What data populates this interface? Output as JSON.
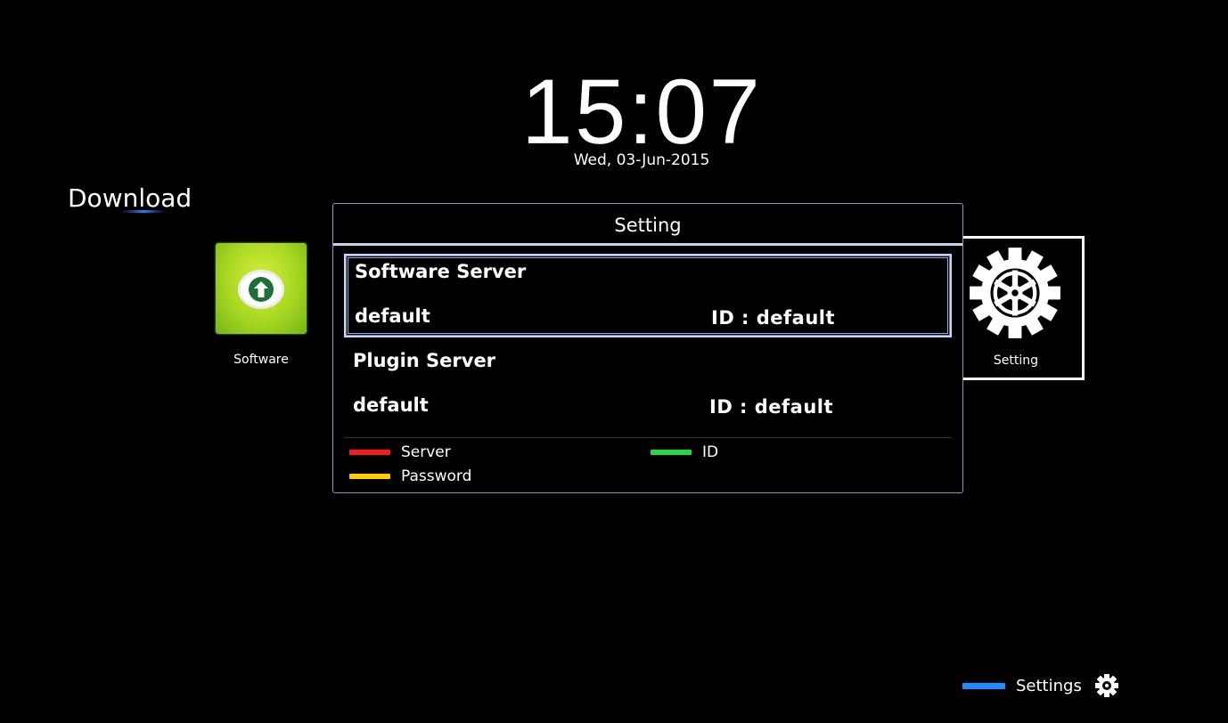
{
  "clock": {
    "time": "15:07",
    "date": "Wed, 03-Jun-2015"
  },
  "page": {
    "title": "Download"
  },
  "apps": {
    "software": {
      "label": "Software",
      "icon": "upload-arrow-icon",
      "color": "#a7d722"
    },
    "setting": {
      "label": "Setting",
      "icon": "gear-icon"
    }
  },
  "dialog": {
    "title": "Setting",
    "rows": [
      {
        "title": "Software Server",
        "value": "default",
        "id_text": "ID : default",
        "selected": true
      },
      {
        "title": "Plugin Server",
        "value": "default",
        "id_text": "ID : default",
        "selected": false
      }
    ],
    "legend": [
      {
        "color": "#ff1a1a",
        "label": "Server"
      },
      {
        "color": "#22dd33",
        "label": "ID"
      },
      {
        "color": "#ffcc00",
        "label": "Password"
      }
    ]
  },
  "bottom_hint": {
    "color": "#1e8cff",
    "label": "Settings",
    "icon": "gear-icon"
  }
}
